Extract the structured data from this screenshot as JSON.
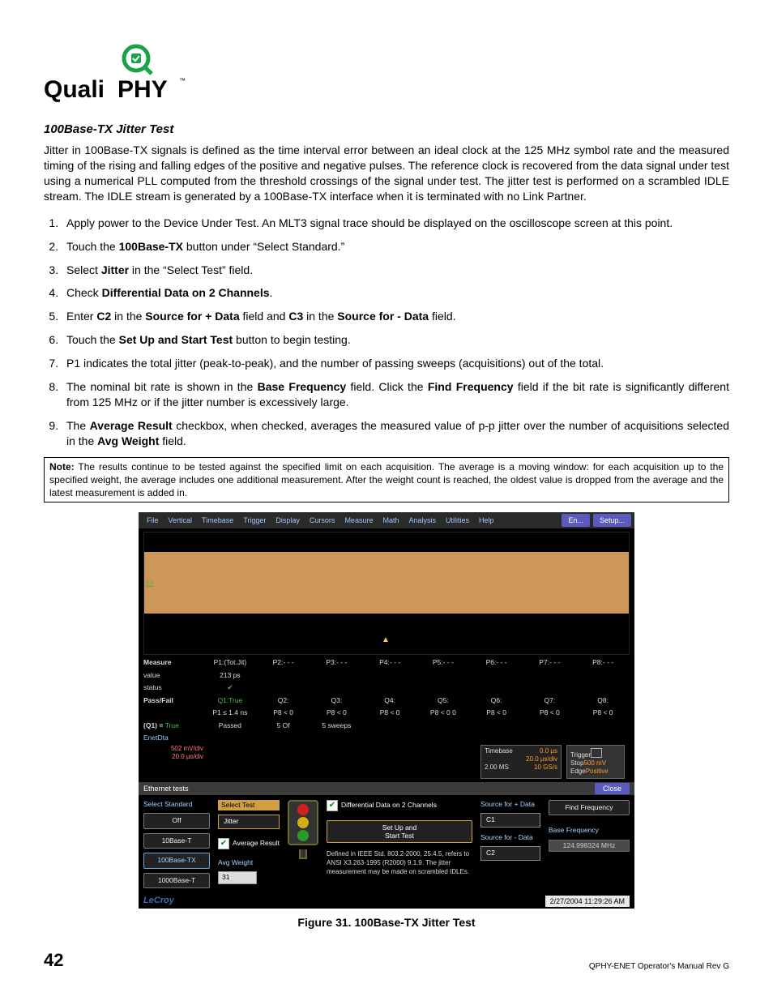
{
  "logo_text": "QualiPHY",
  "section_title": "100Base-TX Jitter Test",
  "intro": "Jitter in 100Base-TX signals is defined as the time interval error between an ideal clock at the 125 MHz symbol rate and the measured timing of the rising and falling edges of the positive and negative pulses. The reference clock is recovered from the data signal under test using a numerical PLL computed from the threshold crossings of the signal under test. The jitter test is performed on a scrambled IDLE stream. The IDLE stream is generated by a 100Base-TX interface when it is terminated with no Link Partner.",
  "steps": {
    "s1": "Apply power to the Device Under Test. An MLT3 signal trace should be displayed on the oscilloscope screen at this point.",
    "s2a": "Touch the ",
    "s2b": "100Base-TX",
    "s2c": " button under “Select Standard.”",
    "s3a": "Select ",
    "s3b": "Jitter",
    "s3c": " in the “Select Test” field.",
    "s4a": "Check ",
    "s4b": "Differential Data on 2 Channels",
    "s4c": ".",
    "s5a": "Enter ",
    "s5b": "C2",
    "s5c": " in the ",
    "s5d": "Source for + Data",
    "s5e": " field and ",
    "s5f": "C3",
    "s5g": " in the ",
    "s5h": "Source for - Data",
    "s5i": " field.",
    "s6a": "Touch the ",
    "s6b": "Set Up and Start Test",
    "s6c": " button to begin testing.",
    "s7": "P1 indicates the total jitter (peak-to-peak), and the number of passing sweeps (acquisitions) out of the total.",
    "s8a": "The nominal bit rate is shown in the ",
    "s8b": "Base Frequency",
    "s8c": " field. Click the ",
    "s8d": "Find Frequency",
    "s8e": " field if the bit rate is significantly different from 125 MHz or if the jitter number is excessively large.",
    "s9a": "The ",
    "s9b": "Average Result",
    "s9c": " checkbox, when checked, averages the measured value of p-p jitter over the number of acquisitions selected in the ",
    "s9d": "Avg Weight",
    "s9e": " field."
  },
  "note_label": "Note:",
  "note_body": " The results continue to be tested against the specified limit on each acquisition. The average is a moving window: for each acquisition up to the specified weight, the average includes one additional measurement. After the weight count is reached, the oldest value is dropped from the average and the latest measurement is added in.",
  "caption": "Figure 31. 100Base-TX Jitter Test",
  "page_number": "42",
  "doc_id": "QPHY-ENET Operator's Manual Rev G",
  "shot": {
    "menu": [
      "File",
      "Vertical",
      "Timebase",
      "Trigger",
      "Display",
      "Cursors",
      "Measure",
      "Math",
      "Analysis",
      "Utilities",
      "Help"
    ],
    "menu_right_btn1": "En...",
    "menu_right_btn2": "Setup...",
    "scope_en_label": "En",
    "measure": {
      "row_label": "Measure",
      "row_value_label": "value",
      "row_status_label": "status",
      "p_labels": [
        "P1:(Tot.Jit)",
        "P2:- - -",
        "P3:- - -",
        "P4:- - -",
        "P5:- - -",
        "P6:- - -",
        "P7:- - -",
        "P8:- - -"
      ],
      "p1_value": "213 ps",
      "p1_status": "✔"
    },
    "passfail": {
      "label": "Pass/Fail",
      "q1": "Q1:True",
      "q1_cond": "P1 ≤ 1.4 ns",
      "q_labels": [
        "Q2:",
        "Q3:",
        "Q4:",
        "Q5:",
        "Q6:",
        "Q7:",
        "Q8:"
      ],
      "q_conds": [
        "P8 < 0",
        "P8 < 0",
        "P8 < 0",
        "P8 < 0 0",
        "P8 < 0",
        "P8 < 0",
        "P8 < 0"
      ]
    },
    "q1_summary_lhs": "(Q1) =",
    "q1_summary_true": "True",
    "q1_summary_passed": "Passed",
    "q1_summary_count": "5  Of",
    "q1_summary_sweeps": "5  sweeps",
    "enetdta_label": "EnetDta",
    "enet_vdiv": "502 mV/div",
    "enet_tdiv": "20.0 µs/div",
    "timebase_card": {
      "title": "Timebase",
      "r1a": "0.0 µs",
      "r2a": "20.0 µs/div",
      "r3l": "2.00 MS",
      "r3r": "10 GS/s"
    },
    "trigger_card": {
      "title": "Trigger",
      "r1": "Stop",
      "r1v": "500 mV",
      "r2": "Edge",
      "r2v": "Positive"
    },
    "panel_title": "Ethernet tests",
    "close_btn": "Close",
    "select_standard_label": "Select Standard",
    "std_buttons": [
      "Off",
      "10Base-T",
      "100Base-TX",
      "1000Base-T"
    ],
    "select_test_label": "Select Test",
    "select_test_value": "Jitter",
    "avg_result_label": "Average Result",
    "avg_weight_label": "Avg Weight",
    "avg_weight_value": "31",
    "diff_data_label": "Differential Data on 2 Channels",
    "setup_btn_line1": "Set Up and",
    "setup_btn_line2": "Start Test",
    "src_plus_label": "Source for + Data",
    "src_plus_value": "C1",
    "src_minus_label": "Source for - Data",
    "src_minus_value": "C2",
    "find_freq_btn": "Find Frequency",
    "base_freq_label": "Base Frequency",
    "base_freq_value": "124.998324 MHz",
    "definition": "Defined in IEEE Std. 803.2-2000, 25.4.5, refers to ANSI X3.263-1995 (R2000) 9.1.9. The jitter measurement may be made on scrambled IDLEs.",
    "brand": "LeCroy",
    "timestamp": "2/27/2004 11:29:26 AM"
  }
}
